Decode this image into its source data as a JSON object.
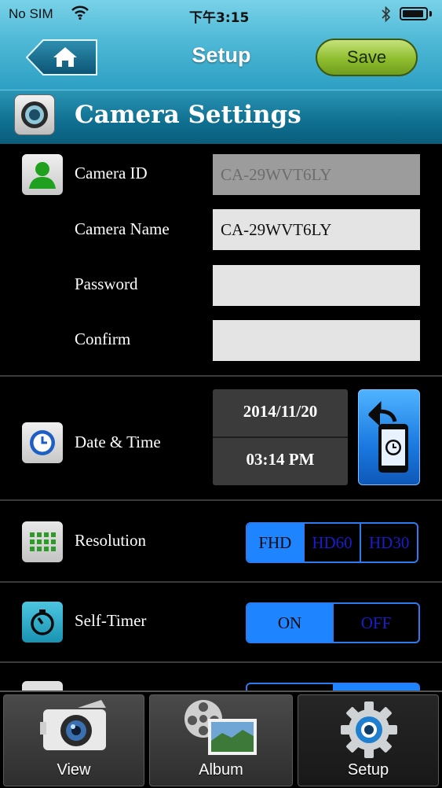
{
  "status_bar": {
    "carrier": "No SIM",
    "time": "下午3:15"
  },
  "header": {
    "title": "Setup",
    "save_label": "Save"
  },
  "section": {
    "title": "Camera Settings"
  },
  "camera": {
    "id_label": "Camera ID",
    "id_value": "CA-29WVT6LY",
    "name_label": "Camera Name",
    "name_value": "CA-29WVT6LY",
    "password_label": "Password",
    "password_value": "",
    "confirm_label": "Confirm",
    "confirm_value": ""
  },
  "datetime": {
    "label": "Date & Time",
    "date": "2014/11/20",
    "time": "03:14 PM"
  },
  "resolution": {
    "label": "Resolution",
    "options": [
      "FHD",
      "HD60",
      "HD30"
    ],
    "selected": "FHD"
  },
  "self_timer": {
    "label": "Self-Timer",
    "options": [
      "ON",
      "OFF"
    ],
    "selected": "ON"
  },
  "tabs": [
    {
      "label": "View"
    },
    {
      "label": "Album"
    },
    {
      "label": "Setup",
      "active": true
    }
  ],
  "colors": {
    "accent": "#1f84ff",
    "header": "#2d9fc3",
    "save": "#8fbd2e"
  }
}
